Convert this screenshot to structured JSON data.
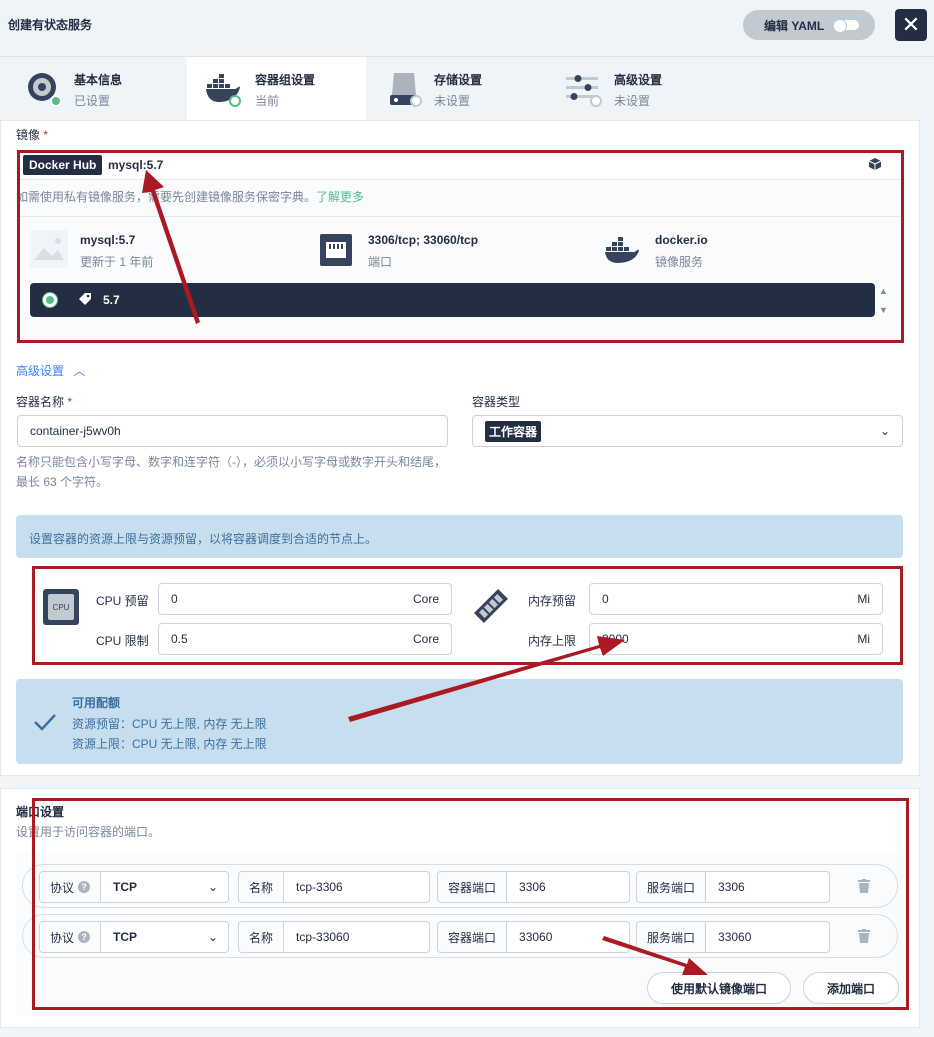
{
  "header": {
    "title": "创建有状态服务",
    "yaml_label": "编辑 YAML",
    "close_icon": "close-icon"
  },
  "tabs": [
    {
      "name": "基本信息",
      "status": "已设置",
      "icon": "info-icon"
    },
    {
      "name": "容器组设置",
      "status": "当前",
      "icon": "docker-icon"
    },
    {
      "name": "存储设置",
      "status": "未设置",
      "icon": "storage-icon"
    },
    {
      "name": "高级设置",
      "status": "未设置",
      "icon": "sliders-icon"
    }
  ],
  "image": {
    "label": "镜像",
    "required": "*",
    "registry_badge": "Docker Hub",
    "value": "mysql:5.7",
    "hint_prefix": "如需使用私有镜像服务，",
    "hint_suffix": "需要先创建镜像服务保密字典。",
    "hint_link": "了解更多",
    "card": {
      "name": "mysql:5.7",
      "updated": "更新于 1 年前",
      "ports": "3306/tcp; 33060/tcp",
      "ports_label": "端口",
      "registry": "docker.io",
      "registry_label": "镜像服务"
    },
    "selected_tag": "5.7"
  },
  "advanced_toggle": "高级设置",
  "container": {
    "name_label": "容器名称",
    "required": "*",
    "name_value": "container-j5wv0h",
    "name_hint": "名称只能包含小写字母、数字和连字符（-），必须以小写字母或数字开头和结尾，最长 63 个字符。",
    "type_label": "容器类型",
    "type_value": "工作容器"
  },
  "resources": {
    "info": "设置容器的资源上限与资源预留，以将容器调度到合适的节点上。",
    "cpu_icon_text": "CPU",
    "cpu_reserve_label": "CPU 预留",
    "cpu_reserve_value": "0",
    "cpu_limit_label": "CPU 限制",
    "cpu_limit_value": "0.5",
    "cpu_unit": "Core",
    "mem_reserve_label": "内存预留",
    "mem_reserve_value": "0",
    "mem_limit_label": "内存上限",
    "mem_limit_value": "2000",
    "mem_unit": "Mi"
  },
  "quota": {
    "title": "可用配额",
    "reserve": "资源预留：CPU 无上限, 内存 无上限",
    "limit": "资源上限：CPU 无上限, 内存 无上限"
  },
  "ports": {
    "title": "端口设置",
    "desc": "设置用于访问容器的端口。",
    "protocol_label": "协议",
    "name_label": "名称",
    "container_port_label": "容器端口",
    "service_port_label": "服务端口",
    "rows": [
      {
        "protocol": "TCP",
        "name": "tcp-3306",
        "container_port": "3306",
        "service_port": "3306"
      },
      {
        "protocol": "TCP",
        "name": "tcp-33060",
        "container_port": "33060",
        "service_port": "33060"
      }
    ],
    "use_default_label": "使用默认镜像端口",
    "add_label": "添加端口"
  }
}
